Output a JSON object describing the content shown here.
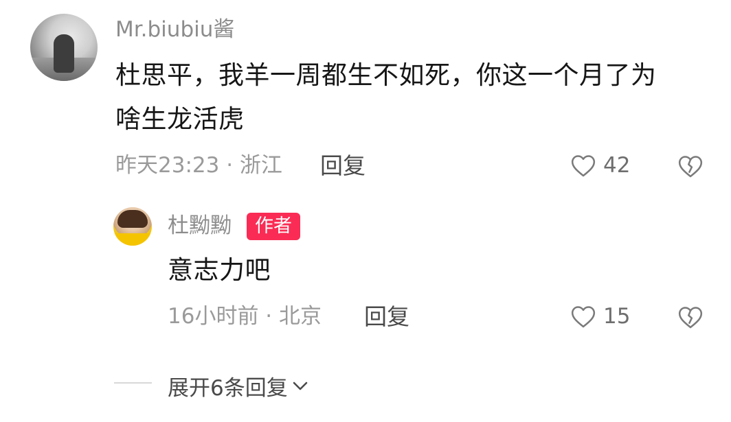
{
  "comment": {
    "username": "Mr.biubiu酱",
    "text_line1": "杜思平，我羊一周都生不如死，你这一个月了为",
    "text_line2": "啥生龙活虎",
    "meta": "昨天23:23 · 浙江",
    "reply_label": "回复",
    "like_count": "42",
    "like_icon": "heart-outline-icon",
    "dislike_icon": "broken-heart-icon"
  },
  "reply": {
    "username": "杜黝黝",
    "badge": "作者",
    "text": "意志力吧",
    "meta": "16小时前 · 北京",
    "reply_label": "回复",
    "like_count": "15"
  },
  "expand": {
    "label": "展开6条回复",
    "icon": "chevron-down-icon"
  },
  "colors": {
    "badge": "#fa2c55",
    "muted": "#9a9a9a",
    "text": "#161616"
  }
}
